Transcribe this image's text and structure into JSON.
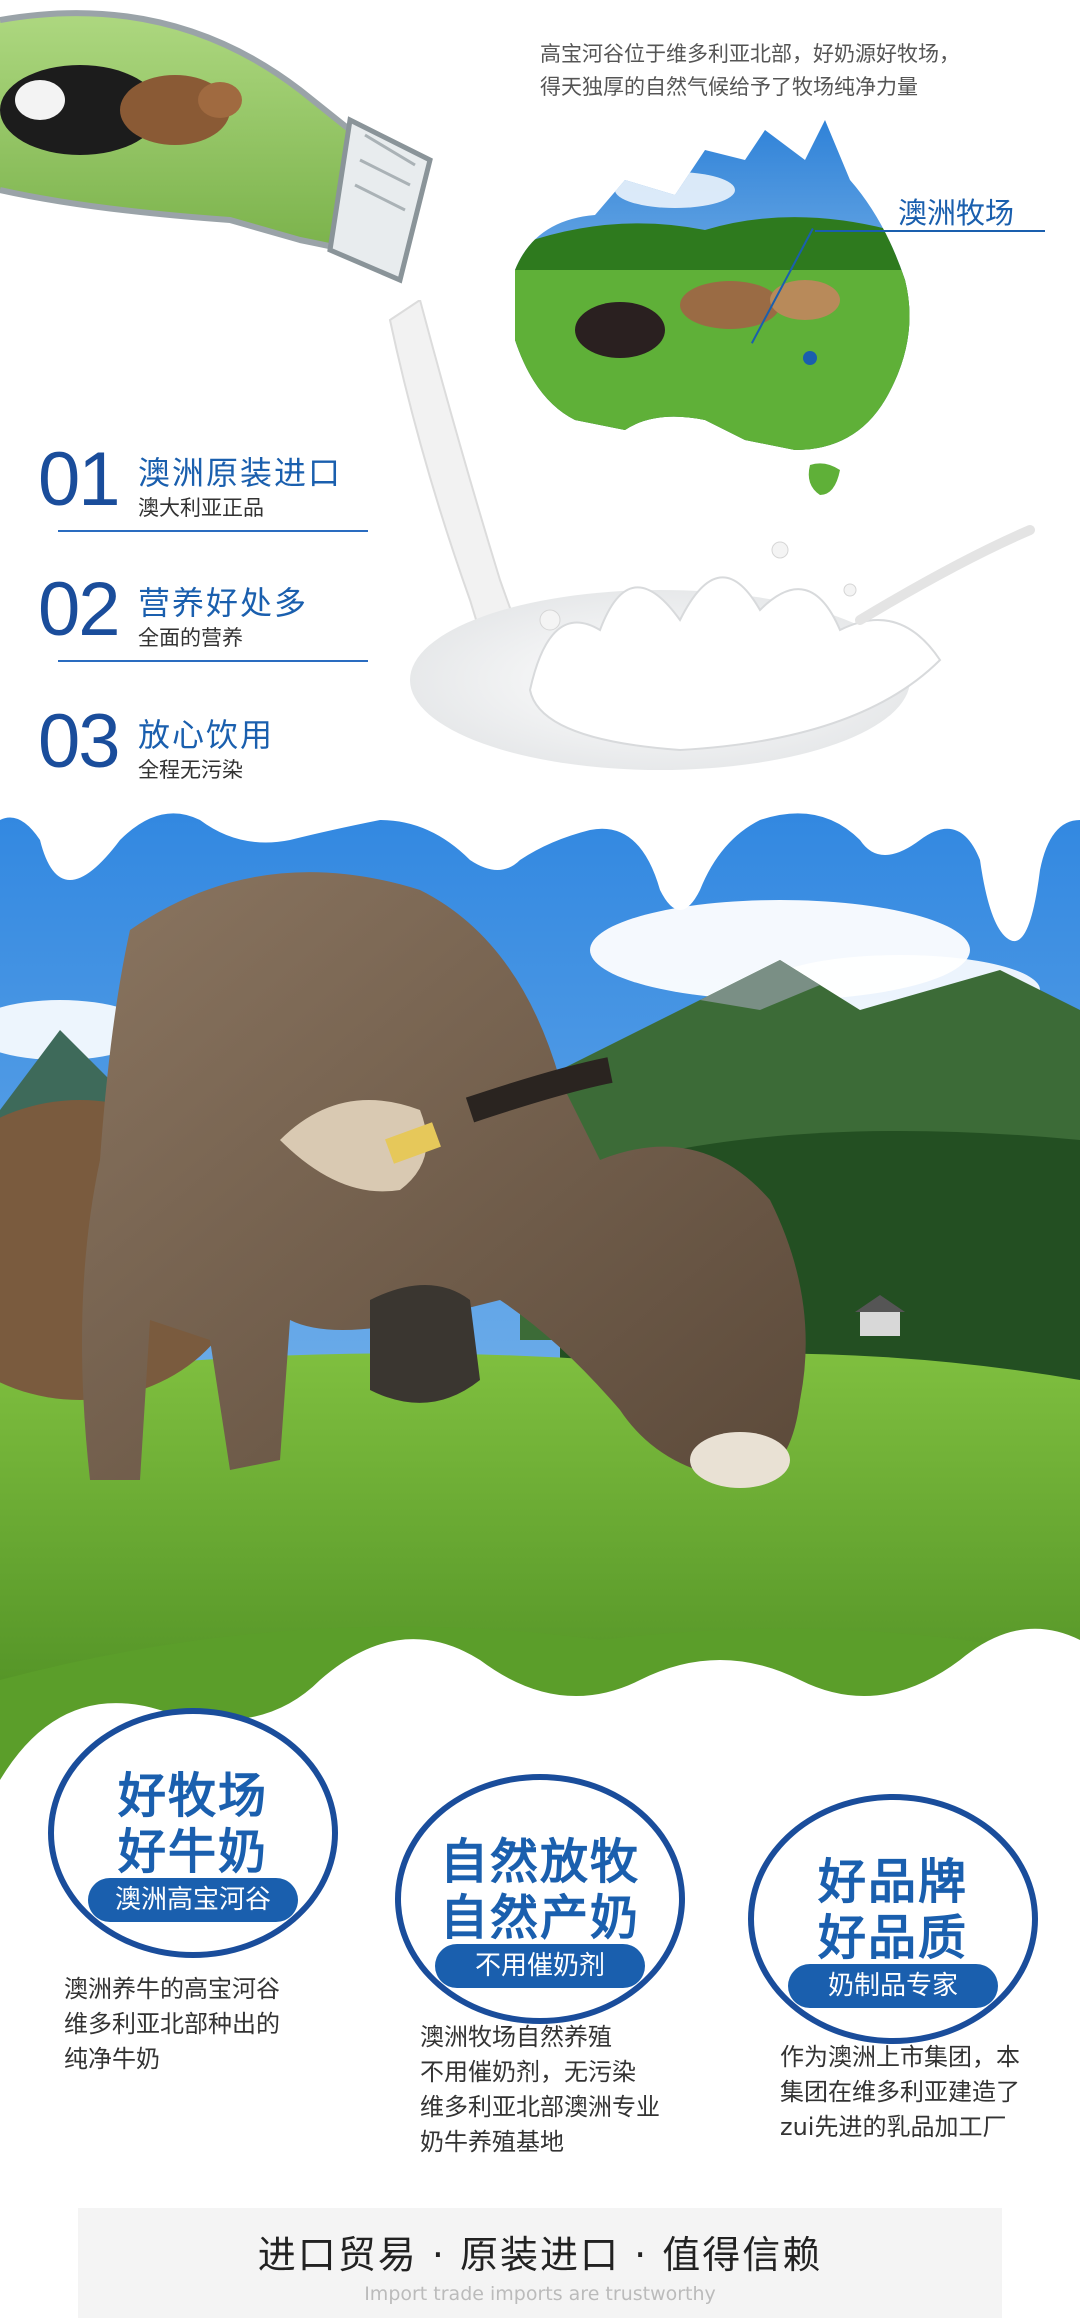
{
  "intro": {
    "line1": "高宝河谷位于维多利亚北部，好奶源好牧场，",
    "line2": "得天独厚的自然气候给予了牧场纯净力量"
  },
  "map": {
    "label": "澳洲牧场"
  },
  "features": [
    {
      "num": "01",
      "title": "澳洲原装进口",
      "sub": "澳大利亚正品"
    },
    {
      "num": "02",
      "title": "营养好处多",
      "sub": "全面的营养"
    },
    {
      "num": "03",
      "title": "放心饮用",
      "sub": "全程无污染"
    }
  ],
  "badges": [
    {
      "line1": "好牧场",
      "line2": "好牛奶",
      "pill": "澳洲高宝河谷",
      "desc": [
        "澳洲养牛的高宝河谷",
        "维多利亚北部种出的",
        "纯净牛奶"
      ]
    },
    {
      "line1": "自然放牧",
      "line2": "自然产奶",
      "pill": "不用催奶剂",
      "desc": [
        "澳洲牧场自然养殖",
        "不用催奶剂，无污染",
        "维多利亚北部澳洲专业",
        "奶牛养殖基地"
      ]
    },
    {
      "line1": "好品牌",
      "line2": "好品质",
      "pill": "奶制品专家",
      "desc": [
        "作为澳洲上市集团，本",
        "集团在维多利亚建造了",
        "zui先进的乳品加工厂"
      ]
    }
  ],
  "footer": {
    "main": "进口贸易 · 原装进口 · 值得信赖",
    "sub": "Import trade imports are trustworthy"
  },
  "colors": {
    "brand_blue": "#1a5fae",
    "dark_blue": "#1a4d9b",
    "grass": "#5da02e",
    "sky": "#4a95dd"
  }
}
